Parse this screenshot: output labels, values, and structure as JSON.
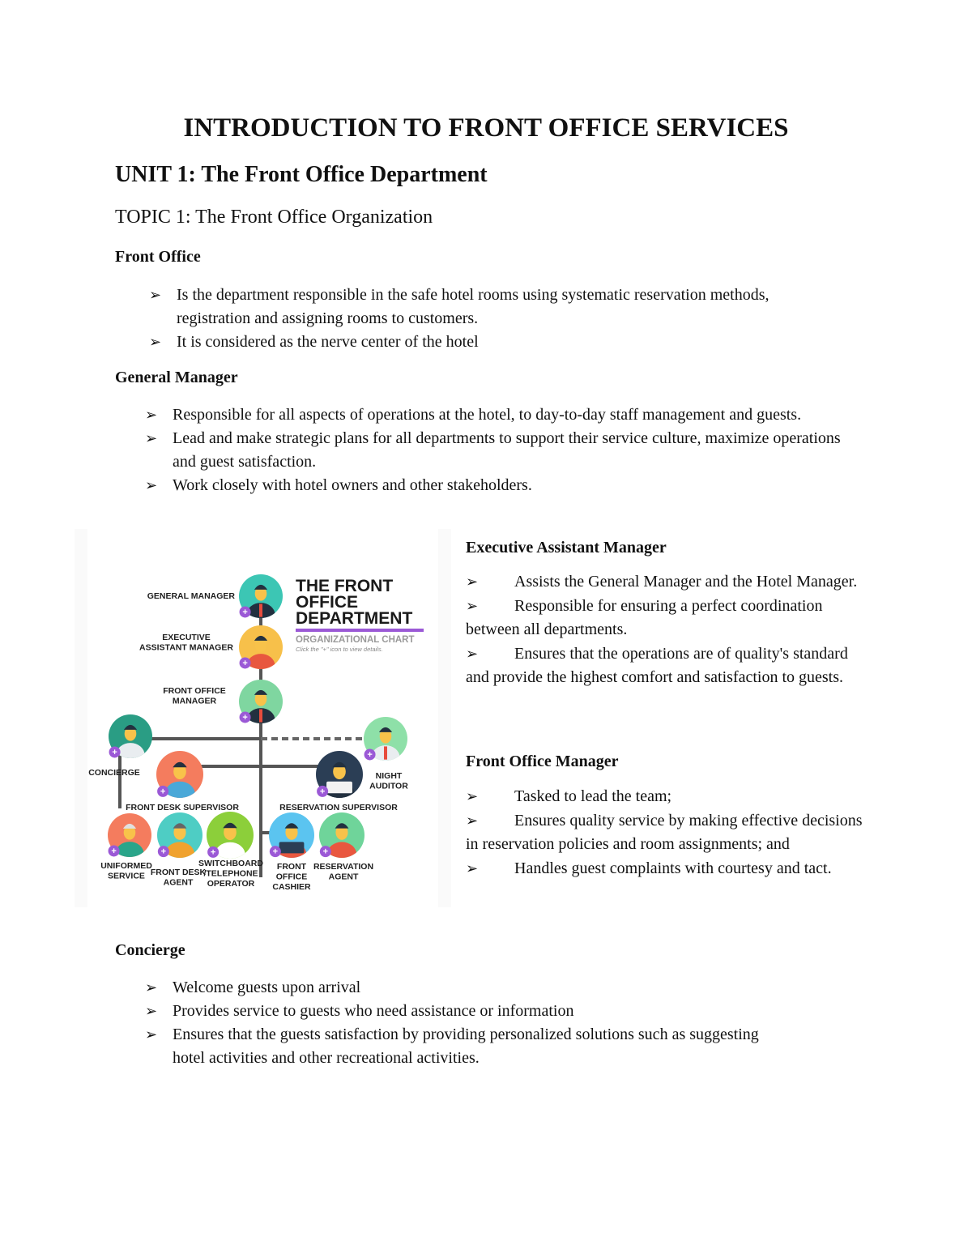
{
  "document": {
    "title": "INTRODUCTION TO FRONT OFFICE SERVICES",
    "unit": "UNIT 1: The Front Office Department",
    "topic": "TOPIC 1: The Front Office Organization",
    "bullet_glyph": "➢",
    "sections": {
      "front_office": {
        "heading": "Front Office",
        "bullets": [
          "Is the department responsible in the safe hotel rooms using systematic reservation methods, registration and assigning rooms to customers.",
          "It is considered as the nerve center of the hotel"
        ]
      },
      "general_manager": {
        "heading": "General Manager",
        "bullets": [
          "Responsible for all aspects of operations at the hotel, to day-to-day staff management and guests.",
          "Lead and make strategic plans for all departments to support their service culture, maximize operations and guest satisfaction.",
          "Work closely with hotel owners and other stakeholders."
        ]
      },
      "executive_assistant_manager": {
        "heading": "Executive Assistant Manager",
        "bullets": [
          "Assists the General Manager and the Hotel Manager.",
          "Responsible for ensuring a perfect coordination between all departments.",
          "Ensures that the operations are of quality's standard and provide the highest comfort and satisfaction to guests."
        ]
      },
      "front_office_manager": {
        "heading": "Front Office Manager",
        "bullets": [
          "Tasked to lead the team;",
          "Ensures quality service by making effective decisions in reservation policies and room assignments; and",
          "Handles guest complaints with courtesy and tact."
        ]
      },
      "concierge": {
        "heading": "Concierge",
        "bullets": [
          "Welcome guests upon arrival",
          "Provides service to guests who need assistance or information",
          "Ensures that the guests satisfaction by providing personalized solutions such as suggesting hotel activities and other recreational activities."
        ]
      }
    }
  },
  "org_chart": {
    "title_lines": [
      "THE FRONT",
      "OFFICE",
      "DEPARTMENT"
    ],
    "subtitle": "ORGANIZATIONAL CHART",
    "hint": "Click the \"+\" icon to view details.",
    "accent_color": "#9b59d6",
    "plus_glyph": "+",
    "nodes": [
      {
        "id": "general-manager",
        "label_lines": [
          "GENERAL MANAGER"
        ],
        "color": "#3cc6b4",
        "figure": "man-suit"
      },
      {
        "id": "executive-assistant-manager",
        "label_lines": [
          "EXECUTIVE",
          "ASSISTANT MANAGER"
        ],
        "color": "#f7c04a",
        "figure": "woman-red"
      },
      {
        "id": "front-office-manager",
        "label_lines": [
          "FRONT OFFICE",
          "MANAGER"
        ],
        "color": "#7fd6a0",
        "figure": "man-glasses"
      },
      {
        "id": "concierge",
        "label_lines": [
          "CONCIERGE"
        ],
        "color": "#2a9d84",
        "figure": "woman-white"
      },
      {
        "id": "night-auditor",
        "label_lines": [
          "NIGHT",
          "AUDITOR"
        ],
        "color": "#8ee0a8",
        "figure": "man-tie"
      },
      {
        "id": "front-desk-supervisor",
        "label_lines": [
          "FRONT DESK SUPERVISOR"
        ],
        "color": "#f47c5e",
        "figure": "woman-blue"
      },
      {
        "id": "reservation-supervisor",
        "label_lines": [
          "RESERVATION SUPERVISOR"
        ],
        "color": "#2b3e55",
        "figure": "woman-laptop"
      },
      {
        "id": "uniformed-service",
        "label_lines": [
          "UNIFORMED",
          "SERVICE"
        ],
        "color": "#f47c5e",
        "figure": "bellboy"
      },
      {
        "id": "front-desk-agent",
        "label_lines": [
          "FRONT DESK",
          "AGENT"
        ],
        "color": "#4ecdc4",
        "figure": "woman-gray"
      },
      {
        "id": "switchboard-operator",
        "label_lines": [
          "SWITCHBOARD",
          "/TELEPHONE",
          "OPERATOR"
        ],
        "color": "#8ccf3a",
        "figure": "headset"
      },
      {
        "id": "front-office-cashier",
        "label_lines": [
          "FRONT",
          "OFFICE",
          "CASHIER"
        ],
        "color": "#5bc4f0",
        "figure": "man-laptop"
      },
      {
        "id": "reservation-agent",
        "label_lines": [
          "RESERVATION",
          "AGENT"
        ],
        "color": "#6fd49a",
        "figure": "woman-headset"
      }
    ]
  }
}
